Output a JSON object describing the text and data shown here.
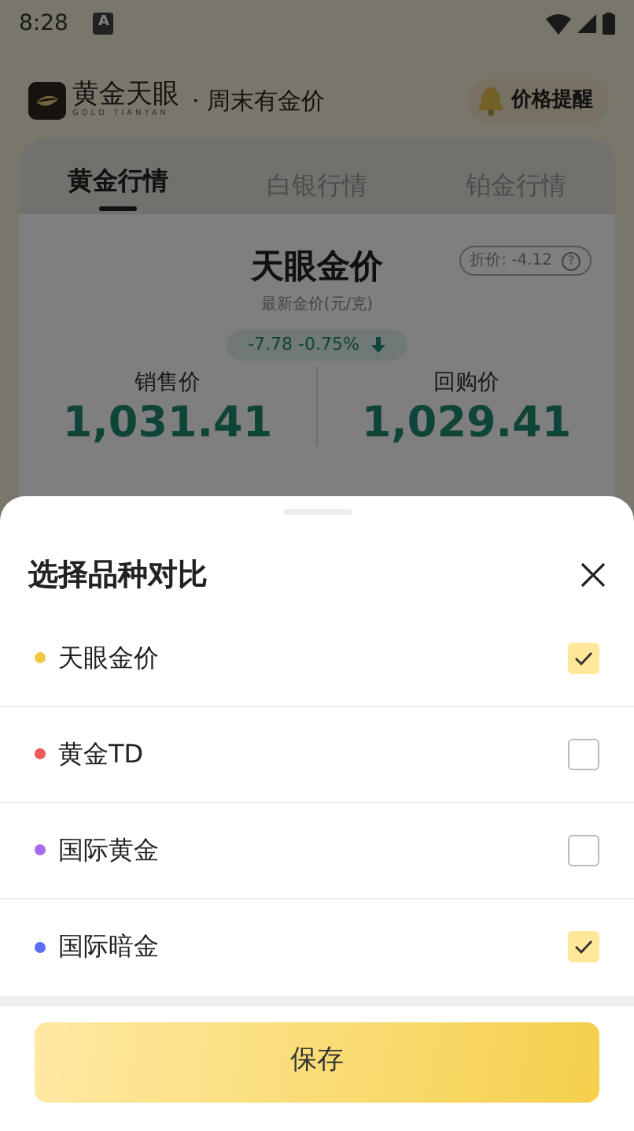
{
  "status_bar": {
    "time": "8:28",
    "notification": "A"
  },
  "header": {
    "brand": "黄金天眼",
    "brand_sub": "GOLD TIANYAN",
    "slogan": "· 周末有金价",
    "alert_button": "价格提醒"
  },
  "tabs": [
    {
      "label": "黄金行情",
      "selected": true
    },
    {
      "label": "白银行情",
      "selected": false
    },
    {
      "label": "铂金行情",
      "selected": false
    }
  ],
  "price_card": {
    "title": "天眼金价",
    "discount": "折价: -4.12",
    "help": "?",
    "subtitle": "最新金价(元/克)",
    "change": "-7.78 -0.75%",
    "prices": [
      {
        "label": "销售价",
        "value": "1,031.41"
      },
      {
        "label": "回购价",
        "value": "1,029.41"
      }
    ]
  },
  "sheet": {
    "title": "选择品种对比",
    "items": [
      {
        "label": "天眼金价",
        "color": "#f5c842",
        "checked": true
      },
      {
        "label": "黄金TD",
        "color": "#f05a5a",
        "checked": false
      },
      {
        "label": "国际黄金",
        "color": "#a86cf0",
        "checked": false
      },
      {
        "label": "国际暗金",
        "color": "#5a6cf0",
        "checked": true
      }
    ],
    "save_button": "保存"
  }
}
